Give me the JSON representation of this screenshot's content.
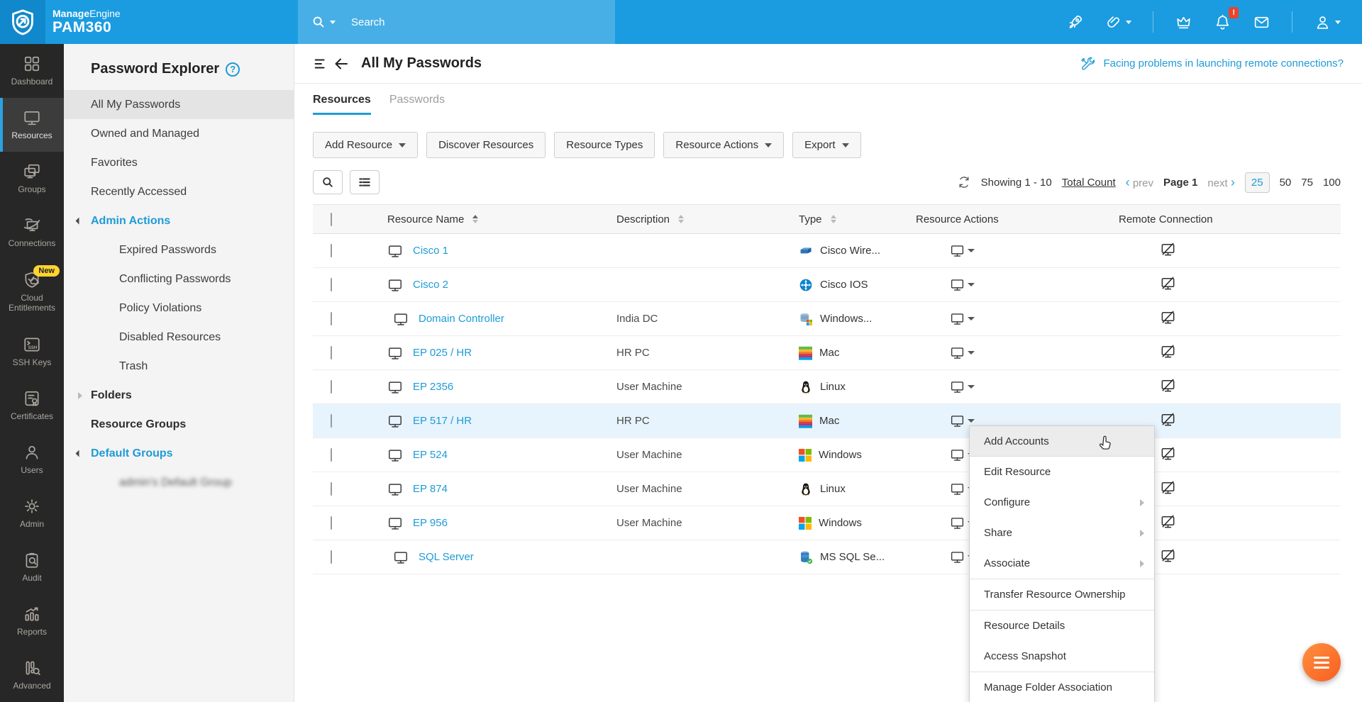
{
  "topbar": {
    "brand_bold": "Manage",
    "brand_light": "Engine",
    "product": "PAM360",
    "search_placeholder": "Search",
    "notification_badge": "!"
  },
  "nav": {
    "items": [
      {
        "label": "Dashboard",
        "icon": "grid-icon"
      },
      {
        "label": "Resources",
        "icon": "monitor-icon",
        "active": true
      },
      {
        "label": "Groups",
        "icon": "monitors-icon"
      },
      {
        "label": "Connections",
        "icon": "orbit-monitor-icon"
      },
      {
        "label": "Cloud Entitlements",
        "icon": "shield-cloud-icon",
        "badge": "New"
      },
      {
        "label": "SSH Keys",
        "icon": "ssh-terminal-icon"
      },
      {
        "label": "Certificates",
        "icon": "certificate-icon"
      },
      {
        "label": "Users",
        "icon": "user-icon"
      },
      {
        "label": "Admin",
        "icon": "gear-icon"
      },
      {
        "label": "Audit",
        "icon": "clipboard-search-icon"
      },
      {
        "label": "Reports",
        "icon": "bar-chart-icon"
      },
      {
        "label": "Advanced",
        "icon": "analytics-search-icon"
      }
    ]
  },
  "explorer": {
    "title": "Password Explorer",
    "help": "?",
    "items": [
      {
        "label": "All My Passwords",
        "active": true
      },
      {
        "label": "Owned and Managed"
      },
      {
        "label": "Favorites"
      },
      {
        "label": "Recently Accessed"
      },
      {
        "label": "Admin Actions",
        "style": "blue",
        "state": "expanded"
      },
      {
        "label": "Expired Passwords",
        "level": "sub"
      },
      {
        "label": "Conflicting Passwords",
        "level": "sub"
      },
      {
        "label": "Policy Violations",
        "level": "sub"
      },
      {
        "label": "Disabled Resources",
        "level": "sub"
      },
      {
        "label": "Trash",
        "level": "sub"
      },
      {
        "label": "Folders",
        "style": "bold",
        "state": "collapsed"
      },
      {
        "label": "Resource Groups",
        "style": "bold"
      },
      {
        "label": "Default Groups",
        "style": "blue",
        "state": "expanded"
      },
      {
        "label": "admin's Default Group",
        "level": "sub",
        "blurred": true
      }
    ]
  },
  "main": {
    "title": "All My Passwords",
    "remote_help": "Facing problems in launching remote connections?",
    "tabs": [
      {
        "label": "Resources",
        "active": true
      },
      {
        "label": "Passwords",
        "active": false
      }
    ],
    "toolbar": [
      {
        "label": "Add Resource",
        "caret": true
      },
      {
        "label": "Discover Resources",
        "caret": false
      },
      {
        "label": "Resource Types",
        "caret": false
      },
      {
        "label": "Resource Actions",
        "caret": true
      },
      {
        "label": "Export",
        "caret": true
      }
    ],
    "pagination": {
      "showing": "Showing 1 - 10",
      "total_label": "Total Count",
      "prev_chevron": "‹",
      "prev": "prev",
      "page": "Page 1",
      "next": "next",
      "next_chevron": "›",
      "sizes": [
        "25",
        "50",
        "75",
        "100"
      ],
      "active_size": "25"
    },
    "table": {
      "columns": [
        "Resource Name",
        "Description",
        "Type",
        "Resource Actions",
        "Remote Connection"
      ],
      "rows": [
        {
          "name": "Cisco 1",
          "description": "",
          "type": "Cisco Wire...",
          "os_icon": "cisco-wireless",
          "highlighted": false
        },
        {
          "name": "Cisco 2",
          "description": "",
          "type": "Cisco IOS",
          "os_icon": "cisco-ios",
          "highlighted": false
        },
        {
          "name": "Domain Controller",
          "description": "India DC",
          "type": "Windows...",
          "os_icon": "windows-database",
          "highlighted": false
        },
        {
          "name": "EP 025 / HR",
          "description": "HR PC",
          "type": "Mac",
          "os_icon": "mac-apple",
          "highlighted": false
        },
        {
          "name": "EP 2356",
          "description": "User Machine",
          "type": "Linux",
          "os_icon": "linux-tux",
          "highlighted": false
        },
        {
          "name": "EP 517 / HR",
          "description": "HR PC",
          "type": "Mac",
          "os_icon": "mac-apple",
          "highlighted": true
        },
        {
          "name": "EP 524",
          "description": "User Machine",
          "type": "Windows",
          "os_icon": "windows-logo",
          "highlighted": false
        },
        {
          "name": "EP 874",
          "description": "User Machine",
          "type": "Linux",
          "os_icon": "linux-tux",
          "highlighted": false
        },
        {
          "name": "EP 956",
          "description": "User Machine",
          "type": "Windows",
          "os_icon": "windows-logo",
          "highlighted": false
        },
        {
          "name": "SQL Server",
          "description": "",
          "type": "MS SQL Se...",
          "os_icon": "mssql-server",
          "highlighted": false
        }
      ]
    },
    "context_menu": {
      "items": [
        {
          "label": "Add Accounts",
          "hovered": true,
          "submenu": false
        },
        {
          "label": "Edit Resource",
          "submenu": false
        },
        {
          "label": "Configure",
          "submenu": true
        },
        {
          "label": "Share",
          "submenu": true
        },
        {
          "label": "Associate",
          "submenu": true,
          "separator_after": true
        },
        {
          "label": "Transfer Resource Ownership",
          "submenu": false,
          "separator_after": true
        },
        {
          "label": "Resource Details",
          "submenu": false
        },
        {
          "label": "Access Snapshot",
          "submenu": false,
          "separator_after": true
        },
        {
          "label": "Manage Folder Association",
          "submenu": false
        }
      ]
    }
  },
  "colors": {
    "topbar": "#1b9ce0",
    "accent": "#1e9bd7",
    "row_highlight": "#e8f4fd",
    "fab": "#f96f28",
    "new_badge": "#ffd42e",
    "alert_badge": "#e8442e"
  }
}
